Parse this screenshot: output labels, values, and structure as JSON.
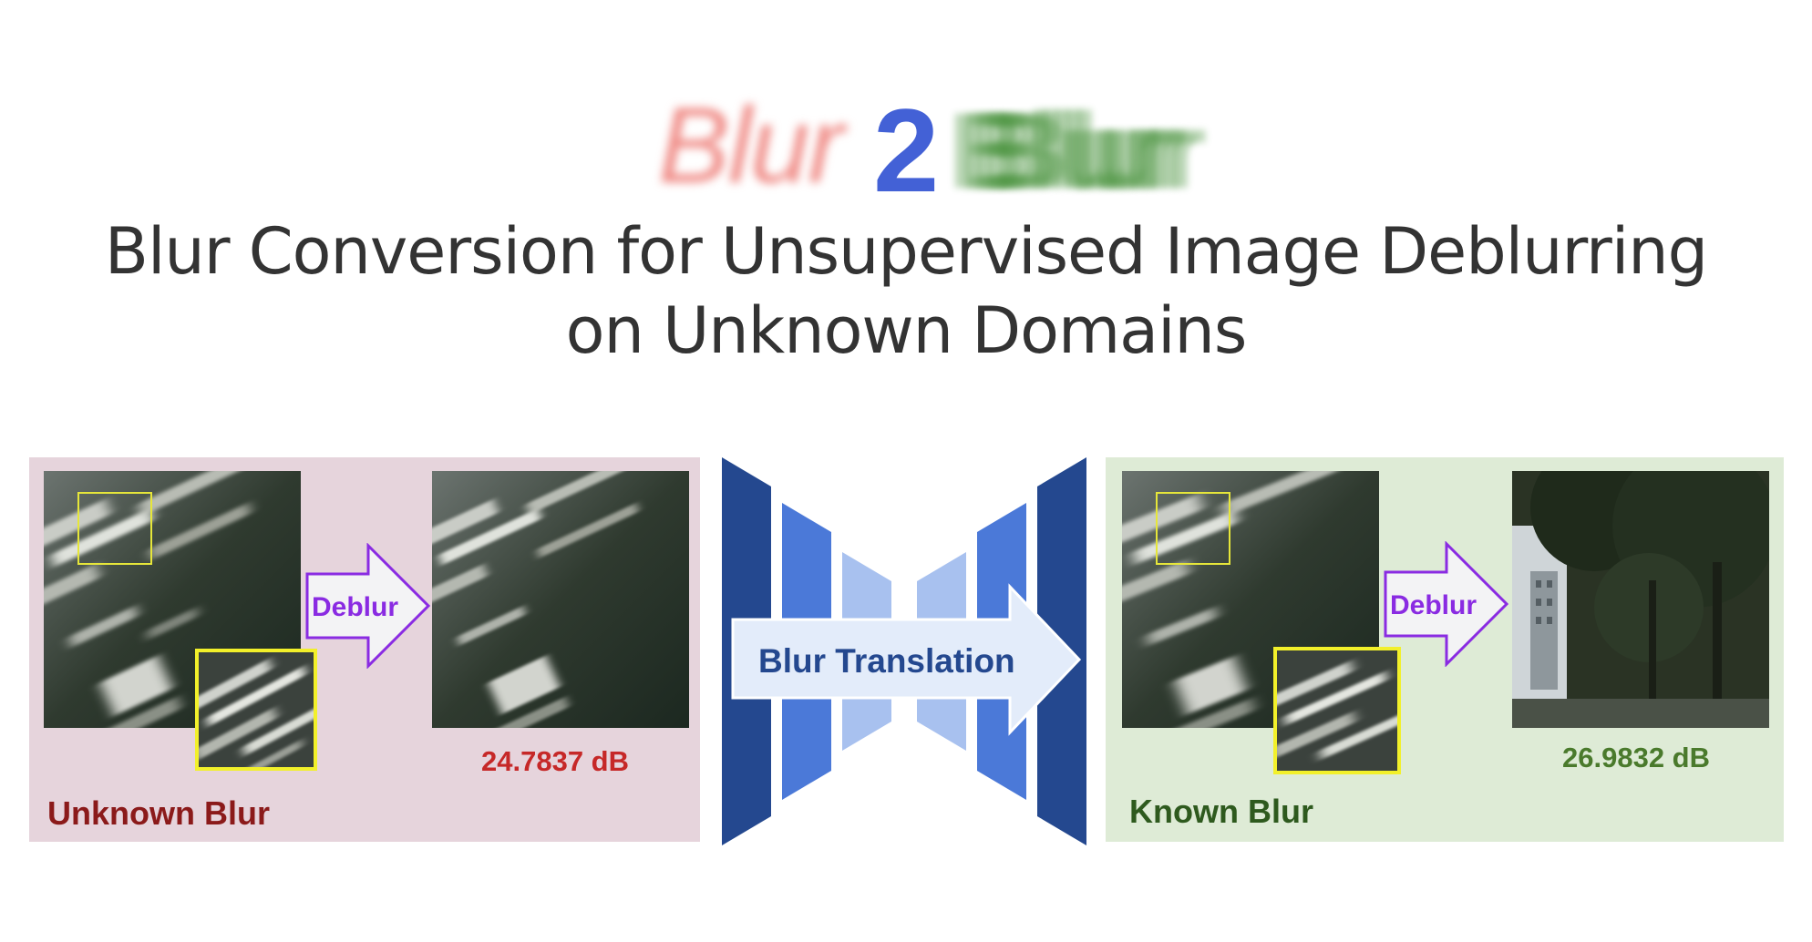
{
  "logo": {
    "word_left": "Blur",
    "number": "2",
    "word_right": "Blur",
    "colors": {
      "left": "#f08d88",
      "number": "#4361d6",
      "right": "#3b8a2e"
    }
  },
  "title": {
    "line1": "Blur Conversion for Unsupervised Image Deblurring",
    "line2": "on Unknown Domains"
  },
  "left_panel": {
    "label": "Unknown Blur",
    "action": "Deblur",
    "psnr": "24.7837 dB",
    "colors": {
      "background": "#e6d4dc",
      "label": "#8b1a1a",
      "psnr": "#c62828"
    }
  },
  "center": {
    "label": "Blur Translation",
    "colors": {
      "dark": "#24488f",
      "mid": "#4b79d8",
      "light": "#a8c1ef"
    }
  },
  "right_panel": {
    "label": "Known Blur",
    "action": "Deblur",
    "psnr": "26.9832 dB",
    "colors": {
      "background": "#deebd6",
      "label": "#2e5a1e",
      "psnr": "#4a7a2c"
    }
  }
}
